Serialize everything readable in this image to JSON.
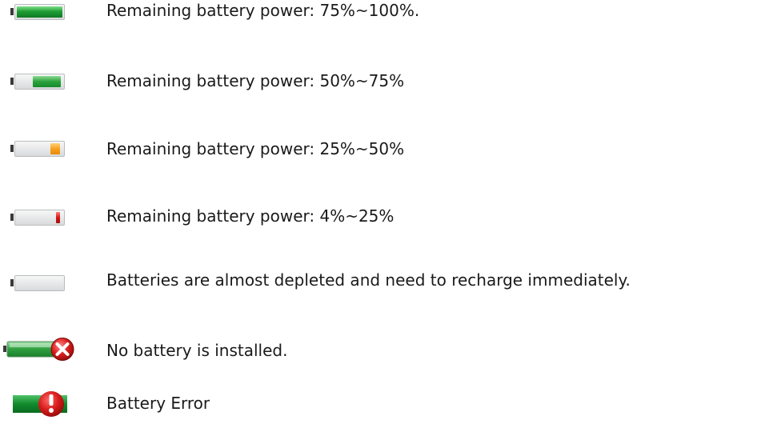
{
  "legend": {
    "items": [
      {
        "icon": "battery-full-icon",
        "level": "75%~100%",
        "fill_fraction": 0.88,
        "fill_color": "#1f9e34",
        "text": "Remaining battery power: 75%~100%."
      },
      {
        "icon": "battery-three-quarter-icon",
        "level": "50%~75%",
        "fill_fraction": 0.66,
        "fill_color": "#2aa23c",
        "text": "Remaining battery power: 50%~75%"
      },
      {
        "icon": "battery-half-icon",
        "level": "25%~50%",
        "fill_fraction": 0.33,
        "fill_color": "#f7a21d",
        "text": "Remaining battery power: 25%~50%"
      },
      {
        "icon": "battery-low-icon",
        "level": "4%~25%",
        "fill_fraction": 0.14,
        "fill_color": "#d41515",
        "text": "Remaining battery power: 4%~25%"
      },
      {
        "icon": "battery-empty-icon",
        "level": "0%",
        "fill_fraction": 0,
        "fill_color": "",
        "text": "Batteries are almost depleted and need to recharge immediately."
      },
      {
        "icon": "battery-not-installed-icon",
        "level": "none",
        "fill_fraction": 0,
        "fill_color": "#d81b1b",
        "text": "No battery is installed."
      },
      {
        "icon": "battery-error-icon",
        "level": "error",
        "fill_fraction": 0,
        "fill_color": "#d81b1b",
        "text": "Battery Error"
      }
    ]
  }
}
